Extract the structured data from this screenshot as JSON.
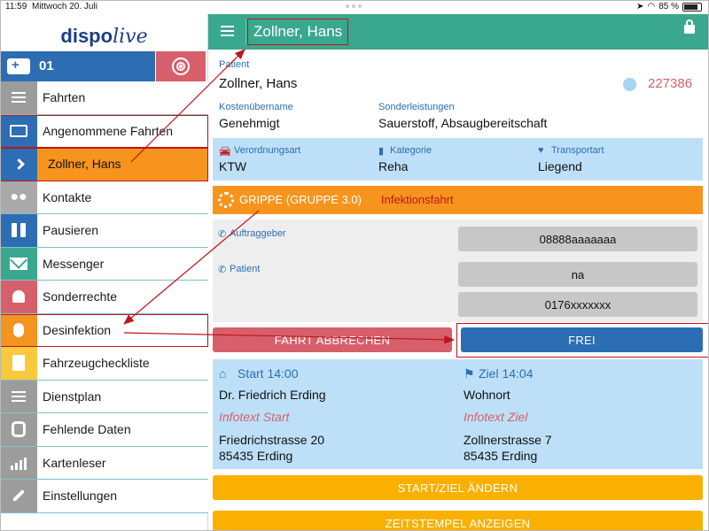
{
  "status_bar": {
    "time": "11:59",
    "date": "Mittwoch 20. Juli",
    "battery": "85 %"
  },
  "sidebar": {
    "logo_left": "disp",
    "logo_mid": "o",
    "logo_right": "live",
    "vehicle_number": "01",
    "items": [
      {
        "label": "Fahrten",
        "icon": "list-icon",
        "color": "grey"
      },
      {
        "label": "Angenommene Fahrten",
        "icon": "id-card-icon",
        "color": "blue"
      },
      {
        "label": "Zollner, Hans",
        "icon": "chevron-right-icon",
        "color": "orange"
      },
      {
        "label": "Kontakte",
        "icon": "users-icon",
        "color": "slate"
      },
      {
        "label": "Pausieren",
        "icon": "pause-icon",
        "color": "blue"
      },
      {
        "label": "Messenger",
        "icon": "envelope-icon",
        "color": "green"
      },
      {
        "label": "Sonderrechte",
        "icon": "bell-icon",
        "color": "red"
      },
      {
        "label": "Desinfektion",
        "icon": "bug-icon",
        "color": "orange"
      },
      {
        "label": "Fahrzeugcheckliste",
        "icon": "document-icon",
        "color": "yellow"
      },
      {
        "label": "Dienstplan",
        "icon": "list-alt-icon",
        "color": "grey"
      },
      {
        "label": "Fehlende Daten",
        "icon": "database-icon",
        "color": "grey"
      },
      {
        "label": "Kartenleser",
        "icon": "signal-bars-icon",
        "color": "grey"
      },
      {
        "label": "Einstellungen",
        "icon": "wrench-icon",
        "color": "grey"
      }
    ]
  },
  "header": {
    "title": "Zollner, Hans"
  },
  "patient": {
    "label": "Patient",
    "name": "Zollner, Hans",
    "id": "227386",
    "kosten_label": "Kostenübername",
    "kosten_value": "Genehmigt",
    "sonder_label": "Sonderleistungen",
    "sonder_value": "Sauerstoff, Absaugbereitschaft"
  },
  "info": {
    "verordnung_label": "Verordnungsart",
    "verordnung_value": "KTW",
    "kategorie_label": "Kategorie",
    "kategorie_value": "Reha",
    "transport_label": "Transportart",
    "transport_value": "Liegend"
  },
  "infection": {
    "group": "GRIPPE (GRUPPE 3.0)",
    "note": "Infektionsfahrt"
  },
  "contacts": {
    "auftraggeber_label": "Auftraggeber",
    "auftraggeber_phone": "08888aaaaaaa",
    "patient_label": "Patient",
    "patient_phone_1": "na",
    "patient_phone_2": "0176xxxxxxx"
  },
  "actions": {
    "cancel_label": "FAHRT ABBRECHEN",
    "frei_label": "FREI",
    "change_label": "START/ZIEL ÄNDERN",
    "timestamps_label": "ZEITSTEMPEL ANZEIGEN"
  },
  "route": {
    "start_title": "Start 14:00",
    "start_name": "Dr. Friedrich Erding",
    "start_info": "Infotext Start",
    "start_street": "Friedrichstrasse 20",
    "start_city": "85435 Erding",
    "ziel_title": "Ziel 14:04",
    "ziel_name": "Wohnort",
    "ziel_info": "Infotext Ziel",
    "ziel_street": "Zollnerstrasse 7",
    "ziel_city": "85435 Erding"
  },
  "colors": {
    "header_green": "#3aa88e",
    "brand_blue": "#2d6db3",
    "accent_orange": "#f7941d",
    "accent_red": "#d75f6b",
    "annotation_red": "#c0151b",
    "info_blue": "#bde0f8",
    "button_yellow": "#f9b000"
  }
}
